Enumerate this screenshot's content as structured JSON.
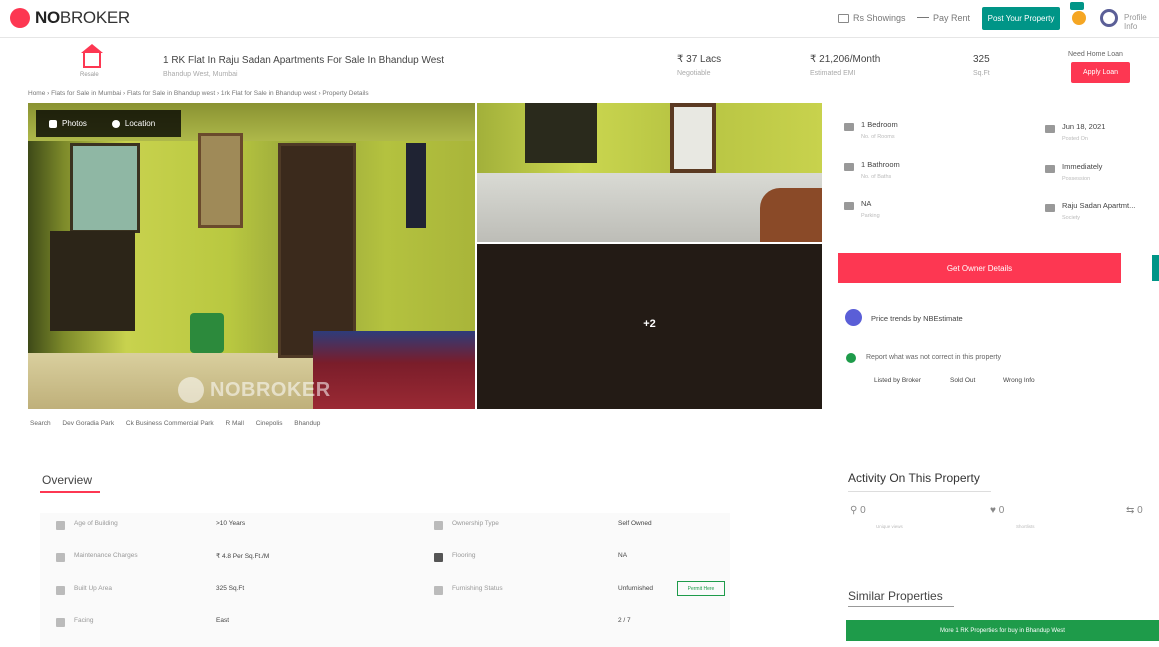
{
  "header": {
    "logo_no": "NO",
    "logo_broker": "BROKER",
    "link_1": "Rs Showings",
    "link_2": "Pay Rent",
    "post_property": "Post Your Property",
    "user": "Profile Info",
    "colors": {
      "brand": "#fd3752",
      "accent": "#009587"
    }
  },
  "property": {
    "title": "1 RK Flat In Raju Sadan Apartments For Sale In Bhandup West",
    "subtitle": "Bhandup West, Mumbai",
    "house_caption": "Resale",
    "price": "₹ 37 Lacs",
    "price_label": "Negotiable",
    "emi": "₹ 21,206/Month",
    "emi_label": "Estimated EMI",
    "area": "325",
    "area_label": "Sq.Ft",
    "loan_caption": "Need Home Loan",
    "loan_button": "Apply Loan"
  },
  "breadcrumb": "Home › Flats for Sale in Mumbai › Flats for Sale in Bhandup west › 1rk Flat for Sale in Bhandup west › Property Details",
  "gallery": {
    "photos_tab": "Photos",
    "location_tab": "Location",
    "watermark": "NOBROKER",
    "more_count": "+2"
  },
  "details": [
    {
      "value": "1 Bedroom",
      "label": "No. of Rooms",
      "icon": "bed-icon"
    },
    {
      "value": "Jun 18, 2021",
      "label": "Posted On",
      "icon": "calendar-icon"
    },
    {
      "value": "1 Bathroom",
      "label": "No. of Baths",
      "icon": "bath-icon"
    },
    {
      "value": "Immediately",
      "label": "Possession",
      "icon": "key-icon"
    },
    {
      "value": "NA",
      "label": "Parking",
      "icon": "parking-icon"
    },
    {
      "value": "Raju Sadan Apartmt...",
      "label": "Society",
      "icon": "building-icon"
    }
  ],
  "actions": {
    "get_owner": "Get Owner Details",
    "price_trends": "Price trends by NBEstimate",
    "report_text": "Report what was not correct in this property",
    "report_options": [
      "Listed by Broker",
      "Sold Out",
      "Wrong Info"
    ]
  },
  "amenities": [
    "Search",
    "Dev Goradia Park",
    "Ck Business Commercial Park",
    "R Mall",
    "Cinepolis",
    "Bhandup"
  ],
  "overview": {
    "title": "Overview",
    "rows": [
      {
        "label": "Age of Building",
        "value": ">10 Years",
        "label2": "Ownership Type",
        "value2": "Self Owned"
      },
      {
        "label": "Maintenance Charges",
        "value": "₹ 4.8 Per Sq.Ft./M",
        "label2": "Flooring",
        "value2": "NA"
      },
      {
        "label": "Built Up Area",
        "value": "325 Sq.Ft",
        "label2": "Furnishing Status",
        "value2": "Unfurnished"
      },
      {
        "label": "Facing",
        "value": "East",
        "label2": "",
        "value2": "2 / 7"
      }
    ],
    "permit_button": "Permit Here"
  },
  "activity": {
    "title": "Activity On This Property",
    "items": [
      {
        "icon": "eye-icon",
        "value": "0",
        "caption": "Unique views"
      },
      {
        "icon": "heart-icon",
        "value": "0",
        "caption": "Shortlists"
      },
      {
        "icon": "chat-icon",
        "value": "0",
        "caption": ""
      }
    ],
    "similar_title": "Similar Properties",
    "similar_button": "More 1 RK Properties for buy in Bhandup West"
  }
}
